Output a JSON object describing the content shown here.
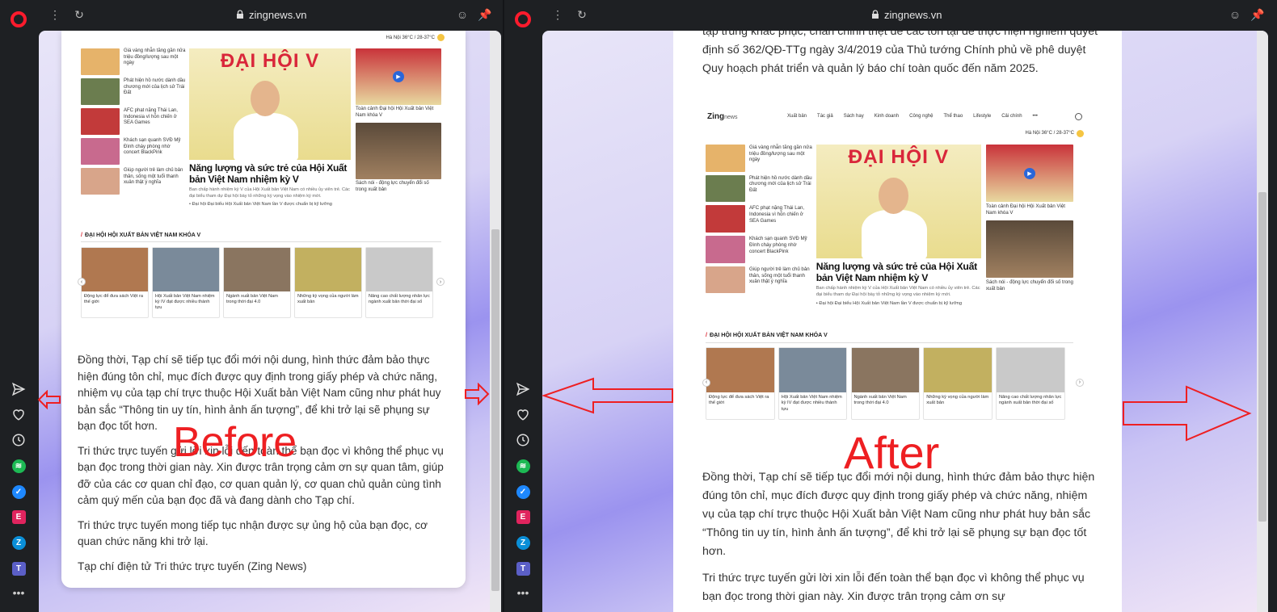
{
  "browser": {
    "address": "zingnews.vn"
  },
  "labels": {
    "before": "Before",
    "after": "After"
  },
  "colors": {
    "accent": "#ff1b2d",
    "annotation": "#ee1f22"
  },
  "sidebar": {
    "icons": [
      "opera-logo",
      "send-icon",
      "heart-icon",
      "history-icon",
      "spotify-icon",
      "messenger-icon",
      "ebook-icon",
      "zalo-icon",
      "teams-icon",
      "more-icon"
    ]
  },
  "site": {
    "nav": [
      "Xuất bản",
      "Tác giả",
      "Sách hay",
      "Kinh doanh",
      "Công nghệ",
      "Thể thao",
      "Lifestyle",
      "Cải chính",
      "•••"
    ],
    "weather": "Hà Nội 36°C / 28-37°C",
    "news": [
      "Giá vàng nhẫn tăng gần nửa triệu đồng/lượng sau một ngày",
      "Phát hiện hồ nước dành dầu chương mới của lịch sử Trái Đất",
      "AFC phạt nặng Thái Lan, Indonesia vì hỗn chiến ở SEA Games",
      "Khách sạn quanh SVĐ Mỹ Đình cháy phòng nhờ concert BlackPink",
      "Giúp người trẻ làm chủ bản thân, sống một tuổi thanh xuân thật ý nghĩa"
    ],
    "feature": {
      "banner": "ĐẠI HỘI V",
      "title": "Năng lượng và sức trẻ của Hội Xuất bản Việt Nam nhiệm kỳ V",
      "desc": "Ban chấp hành nhiệm kỳ V của Hội Xuất bản Việt Nam có nhiều ủy viên trẻ. Các đại biểu tham dự Đại hội bày tỏ những kỳ vọng vào nhiệm kỳ mới.",
      "bullet": "• Đại hội Đại biểu Hội Xuất bản Việt Nam lần V được chuẩn bị kỹ lưỡng"
    },
    "side": [
      "Toàn cảnh Đại hội Hội Xuất bản Việt Nam khóa V",
      "Sách nói - động lực chuyển đổi số trong xuất bản"
    ],
    "section_title": "ĐẠI HỘI HỘI XUẤT BẢN VIỆT NAM KHÓA V",
    "carousel": [
      "Động lực để đưa sách Việt ra thế giới",
      "Hội Xuất bản Việt Nam nhiệm kỳ IV đạt được nhiều thành tựu",
      "Ngành xuất bản Việt Nam trong thời đại 4.0",
      "Những kỳ vọng của người làm xuất bản",
      "Nâng cao chất lượng nhân lực ngành xuất bản thời đại số"
    ]
  },
  "article_left": [
    "Đồng thời, Tạp chí sẽ tiếp tục đổi mới nội dung, hình thức đảm bảo thực hiện đúng tôn chỉ, mục đích được quy định trong giấy phép và chức năng, nhiệm vụ của tạp chí trực thuộc Hội Xuất bản Việt Nam cũng như phát huy bản sắc “Thông tin uy tín, hình ảnh ấn tượng”, để khi trở lại sẽ phụng sự bạn đọc tốt hơn.",
    "Tri thức trực tuyến gửi lời xin lỗi đến toàn thể bạn đọc vì không thể phục vụ bạn đọc trong thời gian này. Xin được trân trọng cảm ơn sự quan tâm, giúp đỡ của các cơ quan chỉ đạo, cơ quan quản lý, cơ quan chủ quản cùng tình cảm quý mến của bạn đọc đã và đang dành cho Tạp chí.",
    "Tri thức trực tuyến mong tiếp tục nhận được sự ủng hộ của bạn đọc, cơ quan chức năng khi trở lại.",
    "Tạp chí điện tử Tri thức trực tuyến (Zing News)"
  ],
  "article_right_top": "tập trung khắc phục, chấn chỉnh triệt để các tồn tại để thực hiện nghiêm quyết định số 362/QĐ-TTg ngày 3/4/2019 của Thủ tướng Chính phủ về phê duyệt Quy hoạch phát triển và quản lý báo chí toàn quốc đến năm 2025.",
  "article_right_bottom": [
    "Đồng thời, Tạp chí sẽ tiếp tục đổi mới nội dung, hình thức đảm bảo thực hiện đúng tôn chỉ, mục đích được quy định trong giấy phép và chức năng, nhiệm vụ của tạp chí trực thuộc Hội Xuất bản Việt Nam cũng như phát huy bản sắc “Thông tin uy tín, hình ảnh ấn tượng”, để khi trở lại sẽ phụng sự bạn đọc tốt hơn.",
    "Tri thức trực tuyến gửi lời xin lỗi đến toàn thể bạn đọc vì không thể phục vụ bạn đọc trong thời gian này. Xin được trân trọng cảm ơn sự"
  ]
}
